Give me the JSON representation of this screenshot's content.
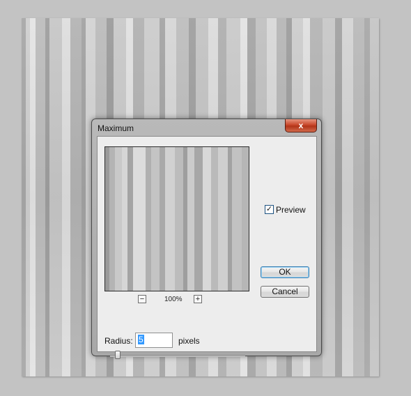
{
  "dialog": {
    "title": "Maximum",
    "close_glyph": "x",
    "ok_label": "OK",
    "cancel_label": "Cancel",
    "preview_label": "Preview",
    "preview_checked": true,
    "zoom_out_label": "−",
    "zoom_in_label": "+",
    "zoom_level": "100%",
    "radius_label": "Radius:",
    "radius_value": "5",
    "radius_units": "pixels"
  }
}
